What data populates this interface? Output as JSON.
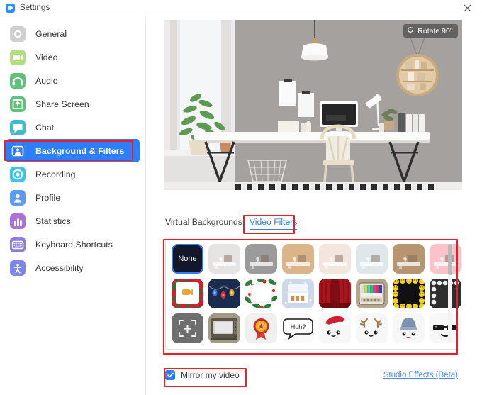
{
  "window": {
    "title": "Settings",
    "logo_icon": "zoom-logo-icon",
    "close_icon": "close-icon"
  },
  "sidebar": {
    "items": [
      {
        "label": "General",
        "icon": "gear-icon",
        "active": false
      },
      {
        "label": "Video",
        "icon": "video-camera-icon",
        "active": false
      },
      {
        "label": "Audio",
        "icon": "headphones-icon",
        "active": false
      },
      {
        "label": "Share Screen",
        "icon": "share-screen-icon",
        "active": false
      },
      {
        "label": "Chat",
        "icon": "chat-bubble-icon",
        "active": false
      },
      {
        "label": "Background & Filters",
        "icon": "person-frame-icon",
        "active": true
      },
      {
        "label": "Recording",
        "icon": "record-circle-icon",
        "active": false
      },
      {
        "label": "Profile",
        "icon": "person-icon",
        "active": false
      },
      {
        "label": "Statistics",
        "icon": "bar-chart-icon",
        "active": false
      },
      {
        "label": "Keyboard Shortcuts",
        "icon": "keyboard-icon",
        "active": false
      },
      {
        "label": "Accessibility",
        "icon": "accessibility-icon",
        "active": false
      }
    ]
  },
  "preview": {
    "rotate_label": "Rotate 90°",
    "rotate_icon": "rotate-icon",
    "scene_description": "Home office with gray wall, pendant lamp, white desk, monitor, chair, window with plants, round wall shelf"
  },
  "tabs": [
    {
      "label": "Virtual Backgrounds",
      "active": false
    },
    {
      "label": "Video Filters",
      "active": true
    }
  ],
  "filters": {
    "rows": [
      [
        {
          "name": "None",
          "label": "None",
          "kind": "none"
        },
        {
          "name": "Light Gray",
          "label": "",
          "kind": "tint",
          "color": "#e6e4e2"
        },
        {
          "name": "Gray",
          "label": "",
          "kind": "tint",
          "color": "#9b9b9b"
        },
        {
          "name": "Tan",
          "label": "",
          "kind": "tint",
          "color": "#dcb48a"
        },
        {
          "name": "Cream",
          "label": "",
          "kind": "tint",
          "color": "#f2e6df"
        },
        {
          "name": "Cool Blue",
          "label": "",
          "kind": "tint",
          "color": "#dfe7ea"
        },
        {
          "name": "Sepia",
          "label": "",
          "kind": "tint",
          "color": "#b89571"
        },
        {
          "name": "Pink",
          "label": "",
          "kind": "tint",
          "color": "#f9c3c9"
        }
      ],
      [
        {
          "name": "Candy Cane Frame",
          "label": "",
          "kind": "candy"
        },
        {
          "name": "String Lights",
          "label": "",
          "kind": "lights"
        },
        {
          "name": "Holly Wreath Frame",
          "label": "",
          "kind": "holly"
        },
        {
          "name": "Gingerbread House",
          "label": "",
          "kind": "house"
        },
        {
          "name": "Red Curtains",
          "label": "",
          "kind": "curtains"
        },
        {
          "name": "Retro TV",
          "label": "",
          "kind": "tv"
        },
        {
          "name": "Emoji Frame",
          "label": "",
          "kind": "emoji"
        },
        {
          "name": "Pearl Frame",
          "label": "",
          "kind": "pearl"
        }
      ],
      [
        {
          "name": "Focus Frame",
          "label": "",
          "kind": "focus"
        },
        {
          "name": "Vintage TV",
          "label": "",
          "kind": "oldtv"
        },
        {
          "name": "Award Ribbon",
          "label": "",
          "kind": "ribbon"
        },
        {
          "name": "Speech Bubble",
          "label": "Huh?",
          "kind": "bubble"
        },
        {
          "name": "Santa Hat",
          "label": "",
          "kind": "santa"
        },
        {
          "name": "Reindeer Antlers",
          "label": "",
          "kind": "antlers"
        },
        {
          "name": "Winter Beanie",
          "label": "",
          "kind": "beanie"
        },
        {
          "name": "Sunglasses",
          "label": "",
          "kind": "sunglasses"
        }
      ]
    ]
  },
  "bottom": {
    "mirror_label": "Mirror my video",
    "mirror_checked": true,
    "studio_link": "Studio Effects (Beta)"
  },
  "colors": {
    "accent": "#2D7FF9",
    "annotation": "#ee1c25",
    "link": "#4a8cf7"
  }
}
